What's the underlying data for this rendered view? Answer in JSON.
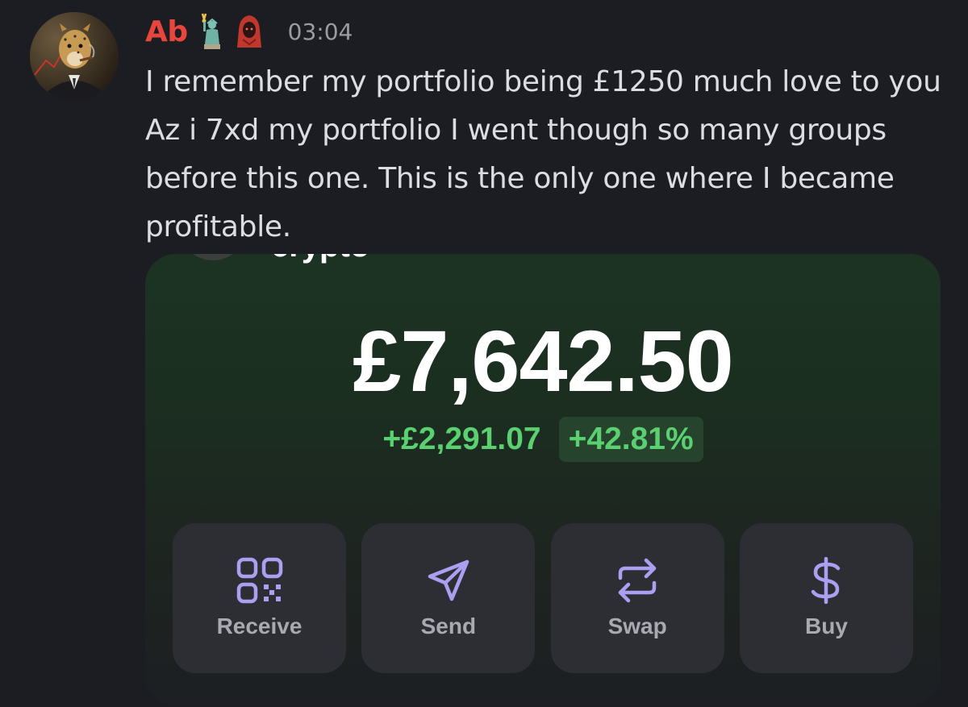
{
  "message": {
    "username": "Ab",
    "badges": [
      "statue-of-liberty-icon",
      "hooded-figure-icon"
    ],
    "timestamp": "03:04",
    "text": "I remember my portfolio being £1250 much love to you Az i 7xd my portfolio I went though so many groups before this one. This is the only one where I became profitable."
  },
  "wallet": {
    "account_name": "crypto",
    "balance": "£7,642.50",
    "change_amount": "+£2,291.07",
    "change_percent": "+42.81%",
    "actions": [
      {
        "label": "Receive",
        "icon": "qr-code-icon"
      },
      {
        "label": "Send",
        "icon": "send-arrow-icon"
      },
      {
        "label": "Swap",
        "icon": "swap-arrows-icon"
      },
      {
        "label": "Buy",
        "icon": "dollar-icon"
      }
    ]
  },
  "colors": {
    "background": "#1c1d22",
    "username": "#e8453c",
    "positive": "#5bd070",
    "accent_purple": "#ab9ff2",
    "card_green": "#1c3323"
  }
}
